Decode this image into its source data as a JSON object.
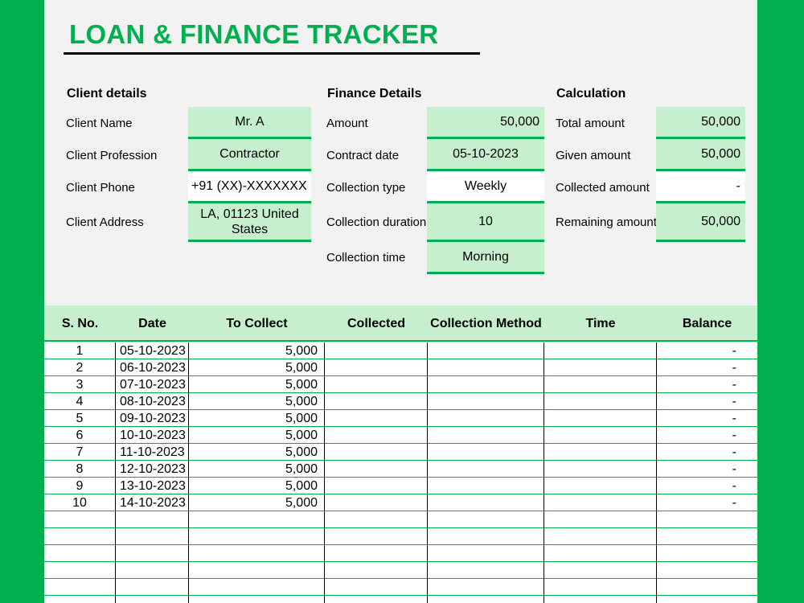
{
  "title": "LOAN & FINANCE TRACKER",
  "client": {
    "heading": "Client details",
    "name_label": "Client Name",
    "name_value": "Mr. A",
    "profession_label": "Client Profession",
    "profession_value": "Contractor",
    "phone_label": "Client Phone",
    "phone_value": "+91 (XX)-XXXXXXX",
    "address_label": "Client Address",
    "address_value": "LA, 01123 United States"
  },
  "finance": {
    "heading": "Finance Details",
    "amount_label": "Amount",
    "amount_value": "50,000",
    "contract_date_label": "Contract date",
    "contract_date_value": "05-10-2023",
    "collection_type_label": "Collection type",
    "collection_type_value": "Weekly",
    "collection_duration_label": "Collection duration",
    "collection_duration_value": "10",
    "collection_time_label": "Collection time",
    "collection_time_value": "Morning"
  },
  "calculation": {
    "heading": "Calculation",
    "total_label": "Total amount",
    "total_value": "50,000",
    "given_label": "Given amount",
    "given_value": "50,000",
    "collected_label": "Collected amount",
    "collected_value": "-",
    "remaining_label": "Remaining amount",
    "remaining_value": "50,000"
  },
  "table": {
    "columns": [
      "S. No.",
      "Date",
      "To Collect",
      "Collected",
      "Collection Method",
      "Time",
      "Balance"
    ],
    "rows": [
      {
        "sno": "1",
        "date": "05-10-2023",
        "to_collect": "5,000",
        "collected": "",
        "method": "",
        "time": "",
        "balance": "-"
      },
      {
        "sno": "2",
        "date": "06-10-2023",
        "to_collect": "5,000",
        "collected": "",
        "method": "",
        "time": "",
        "balance": "-"
      },
      {
        "sno": "3",
        "date": "07-10-2023",
        "to_collect": "5,000",
        "collected": "",
        "method": "",
        "time": "",
        "balance": "-"
      },
      {
        "sno": "4",
        "date": "08-10-2023",
        "to_collect": "5,000",
        "collected": "",
        "method": "",
        "time": "",
        "balance": "-"
      },
      {
        "sno": "5",
        "date": "09-10-2023",
        "to_collect": "5,000",
        "collected": "",
        "method": "",
        "time": "",
        "balance": "-"
      },
      {
        "sno": "6",
        "date": "10-10-2023",
        "to_collect": "5,000",
        "collected": "",
        "method": "",
        "time": "",
        "balance": "-"
      },
      {
        "sno": "7",
        "date": "11-10-2023",
        "to_collect": "5,000",
        "collected": "",
        "method": "",
        "time": "",
        "balance": "-"
      },
      {
        "sno": "8",
        "date": "12-10-2023",
        "to_collect": "5,000",
        "collected": "",
        "method": "",
        "time": "",
        "balance": "-"
      },
      {
        "sno": "9",
        "date": "13-10-2023",
        "to_collect": "5,000",
        "collected": "",
        "method": "",
        "time": "",
        "balance": "-"
      },
      {
        "sno": "10",
        "date": "14-10-2023",
        "to_collect": "5,000",
        "collected": "",
        "method": "",
        "time": "",
        "balance": "-"
      },
      {
        "sno": "",
        "date": "",
        "to_collect": "",
        "collected": "",
        "method": "",
        "time": "",
        "balance": ""
      },
      {
        "sno": "",
        "date": "",
        "to_collect": "",
        "collected": "",
        "method": "",
        "time": "",
        "balance": ""
      },
      {
        "sno": "",
        "date": "",
        "to_collect": "",
        "collected": "",
        "method": "",
        "time": "",
        "balance": ""
      },
      {
        "sno": "",
        "date": "",
        "to_collect": "",
        "collected": "",
        "method": "",
        "time": "",
        "balance": ""
      },
      {
        "sno": "",
        "date": "",
        "to_collect": "",
        "collected": "",
        "method": "",
        "time": "",
        "balance": ""
      },
      {
        "sno": "",
        "date": "",
        "to_collect": "",
        "collected": "",
        "method": "",
        "time": "",
        "balance": ""
      }
    ]
  },
  "colors": {
    "brand_green": "#00b050",
    "light_green": "#c6efce"
  }
}
